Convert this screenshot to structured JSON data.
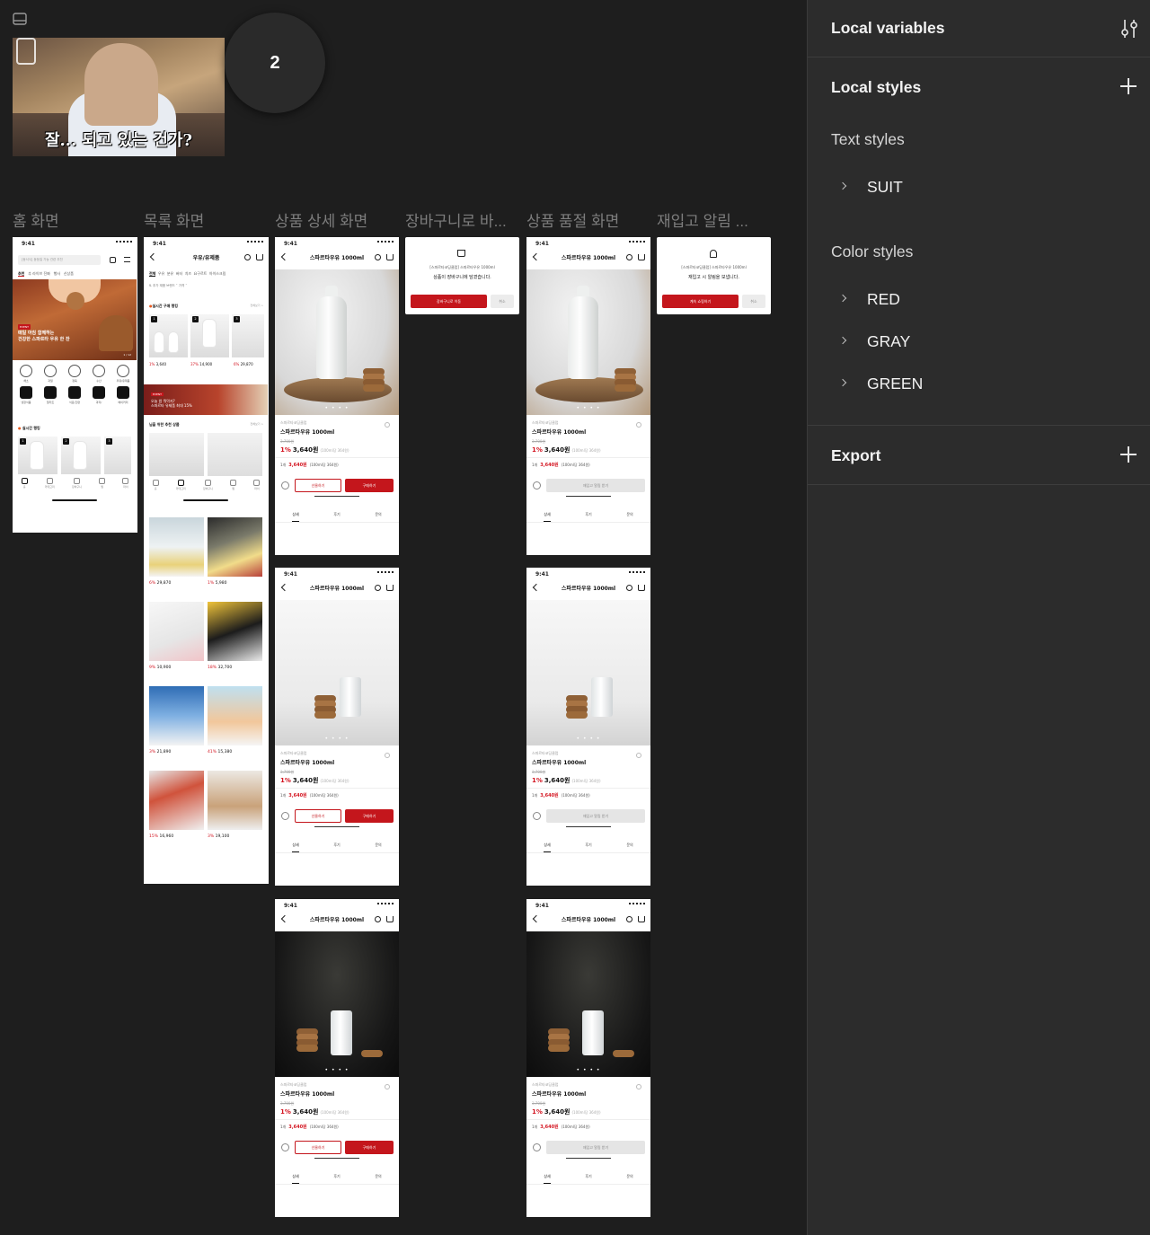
{
  "canvas": {
    "thumbnail": {
      "caption": "잘... 되고 있는 건가?"
    },
    "counter": "2",
    "frames": [
      {
        "id": "home",
        "title": "홈 화면"
      },
      {
        "id": "list",
        "title": "목록 화면"
      },
      {
        "id": "detail",
        "title": "상품 상세 화면"
      },
      {
        "id": "cart",
        "title": "장바구니로 바..."
      },
      {
        "id": "soldout",
        "title": "상품 품절 화면"
      },
      {
        "id": "restock",
        "title": "재입고 알림 ..."
      }
    ]
  },
  "phone": {
    "time": "9:41"
  },
  "home": {
    "search_placeholder": "[동서식] 동등일 가능 관련 추천",
    "tabs": [
      "추천",
      "추 라이브 진짜",
      "행사",
      "신상품"
    ],
    "banner_badge": "EVENT",
    "banner_text_1": "매일 아침 함께하는",
    "banner_text_2": "건강한 스파르타 우유 한 잔",
    "banner_page": "1 / 12",
    "categories_row1": [
      "채소",
      "과일",
      "정육",
      "수산",
      "우유/유제품"
    ],
    "categories_row2": [
      "냉장식품",
      "밀키트",
      "식료/간편",
      "과자/",
      "베이커리"
    ],
    "section": "실시간 랭킹",
    "ranks": [
      "1",
      "2",
      "3"
    ],
    "tabbar": [
      "홈",
      "카테고리",
      "장바구니",
      "찜",
      "마이"
    ]
  },
  "list": {
    "title": "우유/유제품",
    "tabs": [
      "전체",
      "우유",
      "분유",
      "버터",
      "치즈",
      "요구르트",
      "아이스크림"
    ],
    "filter": "⇅ 추가 재품     브랜드 ˅     가격 ˅",
    "section1": "실시간 구매 랭킹",
    "more": "전체보기 >",
    "rank_prices": [
      {
        "pct": "1%",
        "price": "3,640"
      },
      {
        "pct": "37%",
        "price": "14,900"
      },
      {
        "pct": "6%",
        "price": "29,870"
      }
    ],
    "banner_badge": "EVENT",
    "banner_text_1": "오늘 밤 뭐먹지?",
    "banner_text_2": "스파르타 유제품 최대 15%",
    "section2": "님을 위한 추천 상품",
    "section2_more": "전체보기 >",
    "grid": [
      {
        "pct": "6%",
        "price": "29,870"
      },
      {
        "pct": "1%",
        "price": "5,980"
      },
      {
        "pct": "9%",
        "price": "10,900"
      },
      {
        "pct": "18%",
        "price": "32,700"
      },
      {
        "pct": "3%",
        "price": "21,890"
      },
      {
        "pct": "41%",
        "price": "15,380"
      },
      {
        "pct": "15%",
        "price": "16,960"
      },
      {
        "pct": "3%",
        "price": "19,100"
      }
    ],
    "tabbar": [
      "홈",
      "카테고리",
      "장바구니",
      "찜",
      "마이"
    ]
  },
  "detail": {
    "header_title": "스파르타우유 1000ml",
    "brand": "스파르타코딩클럽",
    "name": "스파르타우유 1000ml",
    "orig_price": "3,700원",
    "pct": "1%",
    "price": "3,640원",
    "unit": "(100ml당 364원)",
    "qty": "1개",
    "opt_price": "3,640원",
    "opt_unit": "(100ml당 364원)",
    "gift_button": "선물하기",
    "buy_button": "구매하기",
    "restock_button": "재입고 알림 받기",
    "tabs": [
      "상세",
      "후기",
      "문의"
    ],
    "dots": "• • • •"
  },
  "cart_popup": {
    "line1": "[스파르타코딩클럽] 스파르타우유 1000ml",
    "line2": "상품이 장바구니에 담겼습니다.",
    "primary": "장바구니로 이동",
    "secondary": "취소"
  },
  "restock_popup": {
    "line1": "[스파르타코딩클럽] 스파르타우유 1000ml",
    "line2": "재입고 시 알림을 보냅니다.",
    "primary": "계속 쇼핑하기",
    "secondary": "취소"
  },
  "panel": {
    "local_variables": "Local variables",
    "local_styles": "Local styles",
    "text_styles": "Text styles",
    "text_items": [
      "SUIT"
    ],
    "color_styles": "Color styles",
    "color_items": [
      "RED",
      "GRAY",
      "GREEN"
    ],
    "export": "Export"
  }
}
